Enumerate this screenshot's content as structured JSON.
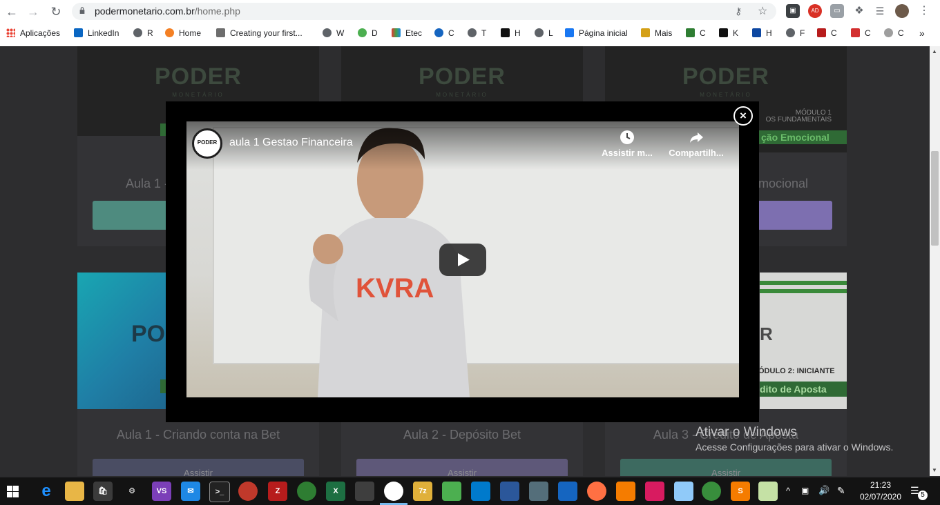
{
  "browser": {
    "url_host": "podermonetario.com.br",
    "url_path": "/home.php",
    "bookmarks": [
      {
        "label": "Aplicações",
        "color": "#1a73e8"
      },
      {
        "label": "LinkedIn",
        "color": "#0a66c2"
      },
      {
        "label": "R",
        "color": "#5f6368"
      },
      {
        "label": "Home",
        "color": "#f48024"
      },
      {
        "label": "Creating your first...",
        "color": "#6d6d6d"
      },
      {
        "label": "W",
        "color": "#5f6368"
      },
      {
        "label": "D",
        "color": "#4caf50"
      },
      {
        "label": "Etec",
        "color": "#e53935"
      },
      {
        "label": "C",
        "color": "#1565c0"
      },
      {
        "label": "T",
        "color": "#5f6368"
      },
      {
        "label": "H",
        "color": "#111111"
      },
      {
        "label": "L",
        "color": "#5f6368"
      },
      {
        "label": "Página inicial",
        "color": "#1877f2"
      },
      {
        "label": "Mais",
        "color": "#d4a017"
      },
      {
        "label": "C",
        "color": "#2e7d32"
      },
      {
        "label": "K",
        "color": "#111111"
      },
      {
        "label": "H",
        "color": "#0d47a1"
      },
      {
        "label": "F",
        "color": "#5f6368"
      },
      {
        "label": "C",
        "color": "#b71c1c"
      },
      {
        "label": "C",
        "color": "#d32f2f"
      },
      {
        "label": "C",
        "color": "#9e9e9e"
      }
    ],
    "more_bookmarks": "»"
  },
  "page": {
    "top_cards": [
      {
        "title": "Aula 1 -",
        "button_color": "#4e8b7f"
      },
      {
        "title": "",
        "button_color": "#4e8b7f"
      },
      {
        "title": "mocional",
        "button_color": "#7d6fb0"
      }
    ],
    "thumb_logo": "PODER",
    "thumb_logo_sub": "MONETÁRIO",
    "third_thumb_module": "MÓDULO 1",
    "third_thumb_sub": "OS FUNDAMENTAIS",
    "third_thumb_banner": "ção Emocional",
    "bottom_cards": [
      {
        "title": "Aula 1 - Criando conta na Bet",
        "button": "Assistir",
        "button_color": "#4a4d63"
      },
      {
        "title": "Aula 2 - Depósito Bet",
        "button": "Assistir",
        "button_color": "#5e5879"
      },
      {
        "title": "Aula 3 - Crédito de Aposta",
        "button": "Assistir",
        "button_color": "#3d6a60"
      }
    ],
    "bottom_third_module": "ÓDULO 2: INICIANTE",
    "bottom_third_banner": "dito de Aposta",
    "bottom_first_logo": "PO",
    "bottom_third_logo": "R"
  },
  "video_modal": {
    "video_title": "aula 1 Gestao Financeira",
    "channel_avatar_text": "PODER",
    "watch_later_label": "Assistir m...",
    "share_label": "Compartilh...",
    "shirt_text": "KVRA",
    "close_symbol": "×"
  },
  "watermark": {
    "title": "Ativar o Windows",
    "subtitle": "Acesse Configurações para ativar o Windows."
  },
  "taskbar": {
    "time": "21:23",
    "date": "02/07/2020",
    "notifications": "5"
  }
}
